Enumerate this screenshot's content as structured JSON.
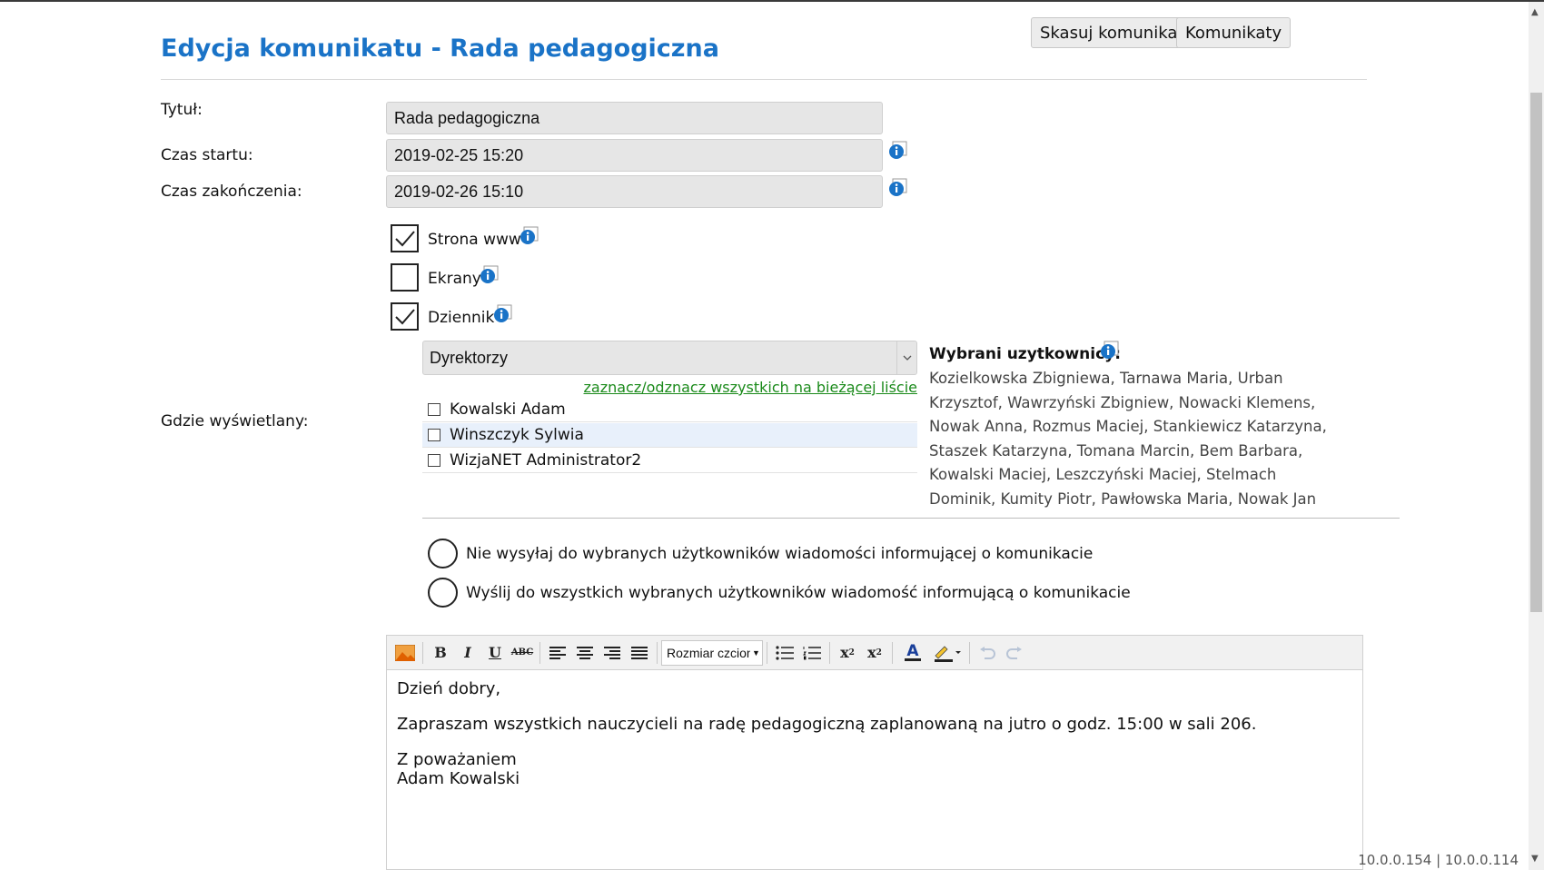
{
  "page": {
    "title": "Edycja komunikatu - Rada pedagogiczna",
    "delete_button": "Skasuj komunikat",
    "list_button": "Komunikaty"
  },
  "form": {
    "title_label": "Tytuł:",
    "title_value": "Rada pedagogiczna",
    "start_label": "Czas startu:",
    "start_value": "2019-02-25 15:20",
    "end_label": "Czas zakończenia:",
    "end_value": "2019-02-26 15:10",
    "where_label": "Gdzie wyświetlany:"
  },
  "channels": [
    {
      "label": "Strona www",
      "checked": true
    },
    {
      "label": "Ekrany",
      "checked": false
    },
    {
      "label": "Dziennik",
      "checked": true
    }
  ],
  "group_select": {
    "value": "Dyrektorzy"
  },
  "toggle_all_link": "zaznacz/odznacz wszystkich na bieżącej liście",
  "users": [
    {
      "name": "Kowalski Adam",
      "checked": false
    },
    {
      "name": "Winszczyk Sylwia",
      "checked": false
    },
    {
      "name": "WizjaNET Administrator2",
      "checked": false
    }
  ],
  "selected_users": {
    "title": "Wybrani uzytkownicy:",
    "list": "Kozielkowska Zbigniewa, Tarnawa Maria, Urban Krzysztof, Wawrzyński Zbigniew, Nowacki Klemens, Nowak Anna, Rozmus Maciej, Stankiewicz Katarzyna, Staszek Katarzyna, Tomana Marcin, Bem Barbara, Kowalski Maciej, Leszczyński Maciej, Stelmach Dominik, Kumity Piotr, Pawłowska Maria, Nowak Jan"
  },
  "notify_options": [
    "Nie wysyłaj do wybranych użytkowników wiadomości informującej o komunikacie",
    "Wyślij do wszystkich wybranych użytkowników wiadomość informującą o komunikacie"
  ],
  "editor": {
    "font_size_combo": "Rozmiar czcionki",
    "toolbar_labels": {
      "bold": "B",
      "italic": "I",
      "underline": "U",
      "strike": "ABC",
      "sub": "x",
      "sup": "x",
      "font_color": "A"
    },
    "paragraph1": "Dzień dobry,",
    "paragraph2": "Zapraszam wszystkich nauczycieli na radę pedagogiczną zaplanowaną na jutro o godz. 15:00 w sali 206.",
    "paragraph3_line1": "Z poważaniem",
    "paragraph3_line2": "Adam Kowalski"
  },
  "footer": {
    "ip": "10.0.0.154 | 10.0.0.114"
  },
  "colors": {
    "title": "#1a73c7",
    "link": "#1a8a1a",
    "info_icon": "#1a73c7"
  }
}
